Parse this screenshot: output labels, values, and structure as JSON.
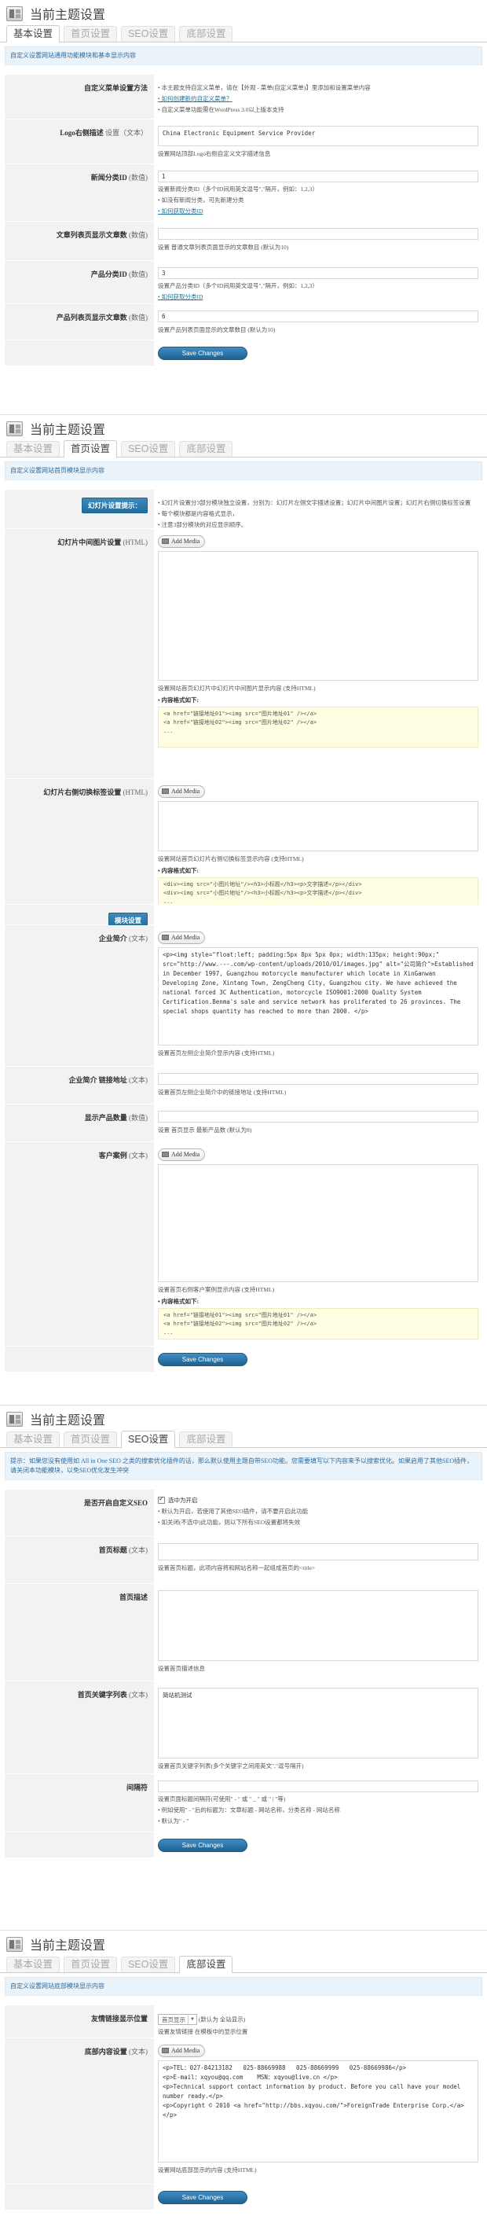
{
  "page_title": "当前主题设置",
  "tabs": [
    "基本设置",
    "首页设置",
    "SEO设置",
    "底部设置"
  ],
  "save_label": "Save Changes",
  "media_label": "Add Media",
  "code_hdr": "• 内容格式如下:",
  "basic": {
    "notice": "自定义设置网站通用功能模块和基本显示内容",
    "menu_label": "自定义菜单设置方法",
    "menu_tips": [
      "• 本主题支持自定义菜单，请在【外观 - 菜单(自定义菜单)】里添加和设置菜单内容",
      "• 如何创建新的自定义菜单？",
      "• 自定义菜单功能需在WordPress 3.0以上版本支持"
    ],
    "logo_label": "Logo右侧描述",
    "logo_type": "设置（文本）",
    "logo_value": "China Electronic Equipment Service Provider",
    "logo_desc": "设置网站顶部Logo右侧自定义文字描述信息",
    "newsid_label": "新闻分类ID",
    "newsid_type": "(数值)",
    "newsid_value": "1",
    "newsid_tips": [
      "设置新闻分类ID（多个ID间用英文逗号\",\"隔开，例如：1,2,3）",
      "• 如没有新闻分类，可先新建分类",
      "• 如何获取分类ID"
    ],
    "artnum_label": "文章列表页显示文章数",
    "artnum_type": "(数值)",
    "artnum_value": "",
    "artnum_desc": "设置 普通文章列表页面显示的文章数目 (默认为10)",
    "prodid_label": "产品分类ID",
    "prodid_type": "(数值)",
    "prodid_value": "3",
    "prodid_tips": [
      "设置产品分类ID（多个ID间用英文逗号\",\"隔开，例如：1,2,3）",
      "• 如何获取分类ID"
    ],
    "prodnum_label": "产品列表页显示文章数",
    "prodnum_type": "(数值)",
    "prodnum_value": "6",
    "prodnum_desc": "设置产品列表页面显示的文章数目 (默认为10)"
  },
  "home": {
    "notice": "自定义设置网站首页模块显示内容",
    "slide_btn": "幻灯片设置提示：",
    "slide_tips": [
      "• 幻灯片设置分3部分模块独立设置，分别为：幻灯片左侧文字描述设置；幻灯片中间图片设置；幻灯片右侧切换标签设置",
      "• 每个模块都是内容格式显示，",
      "• 注意3部分模块的对应显示顺序。"
    ],
    "slide_img_label": "幻灯片中间图片设置",
    "slide_img_type": "(HTML)",
    "slide_img_desc": "设置网站首页幻灯片中幻灯片中间图片显示内容 (支持HTML)",
    "slide_img_code": "<a href=\"链接地址01\"><img src=\"图片地址01\" /></a>\n<a href=\"链接地址02\"><img src=\"图片地址02\" /></a>\n...",
    "slide_tab_label": "幻灯片右侧切换标签设置",
    "slide_tab_type": "(HTML)",
    "slide_tab_desc": "设置网站首页幻灯片右侧切换标签显示内容 (支持HTML)",
    "slide_tab_code": "<div><img src=\"小图片地址\"/><h3>小标题</h3><p>文字描述</p></div>\n<div><img src=\"小图片地址\"/><h3>小标题</h3><p>文字描述</p></div>\n...",
    "module_btn": "模块设置",
    "intro_label": "企业简介",
    "intro_type": "(文本)",
    "intro_value": "<p><img style=\"float:left; padding:5px 8px 5px 0px; width:135px; height:90px;\" src=\"http://www.---.com/wp-content/uploads/2010/01/images.jpg\" alt=\"公司简介\">Established in December 1997, Guangzhou motorcycle manufacturer which locate in XinGanwan Developing Zone, Xintang Town, ZengCheng City, Guangzhou city. We have achieved the national forced 3C Authentication, motorcycle ISO9001:2000 Quality System Certification.Benma's sale and service network has proliferated to 26 provinces. The special shops quantity has reached to more than 2000. </p>",
    "intro_desc": "设置首页左侧企业简介显示内容 (支持HTML)",
    "introlink_label": "企业简介 链接地址",
    "introlink_type": "(文本)",
    "introlink_desc": "设置首页左侧企业简介中的链接地址 (支持HTML)",
    "prodshow_label": "显示产品数量",
    "prodshow_type": "(数值)",
    "prodshow_desc": "设置 首页显示 最新产品数 (默认为8)",
    "case_label": "客户案例",
    "case_type": "(文本)",
    "case_desc": "设置首页右侧客户案例显示内容 (支持HTML)",
    "case_code": "<a href=\"链接地址01\"><img src=\"图片地址01\" /></a>\n<a href=\"链接地址02\"><img src=\"图片地址02\" /></a>\n..."
  },
  "seo": {
    "notice": "提示：如果您没有使用如 All in One SEO 之类的搜索优化插件的话，那么默认使用主题自带SEO功能。您需要填写以下内容来予以搜索优化。如果启用了其他SEO插件，请关闭本功能模块，以免SEO优化发生冲突",
    "notice_link": "All in One SEO",
    "enable_label": "是否开启自定义SEO",
    "enable_check": "选中为开启",
    "enable_tips": [
      "• 默认为开启，若使用了其他SEO插件，请不要开启此功能",
      "• 如关闭(不选中)此功能，则以下所有SEO设置都将失效"
    ],
    "title_label": "首页标题",
    "title_type": "(文本)",
    "title_desc": "设置首页标题，此项内容将和网站名称一起组成首页的<title>",
    "desc_label": "首页描述",
    "desc_desc": "设置首页描述信息",
    "kw_label": "首页关键字列表",
    "kw_type": "(文本)",
    "kw_value": "简站机测试",
    "kw_desc": "设置首页关键字列表(多个关键字之间用英文\",\"逗号隔开)",
    "sep_label": "间隔符",
    "sep_tips": [
      "设置页面标题间隔符(可使用\" - \" 或 \" _ \" 或 \" | \"等)",
      "• 例如使用\" - \"后的标题为：文章标题 - 网站名称，分类名称 - 网站名称",
      "• 默认为\" - \""
    ]
  },
  "footer": {
    "notice": "自定义设置网站底部模块显示内容",
    "link_label": "友情链接显示位置",
    "link_select": "首页显示",
    "link_tips": [
      "(默认为 全站显示)",
      "设置友情链接 在模板中的显示位置"
    ],
    "foot_label": "底部内容设置",
    "foot_type": "(文本)",
    "foot_value": "<p>TEL：027-84213182   025-88669988   025-88669999   025-88669986</p>\n<p>E-mail：xqyou@qq.com    MSN：xqyou@live.cn </p>\n<p>Technical support contact information by product. Before you call have your model number ready.</p>\n<p>Copyright © 2010 <a href=\"http://bbs.xqyou.com/\">ForeignTrade Enterprise Corp.</a></p>",
    "foot_desc": "设置网站底部显示的内容 (支持HTML)"
  }
}
